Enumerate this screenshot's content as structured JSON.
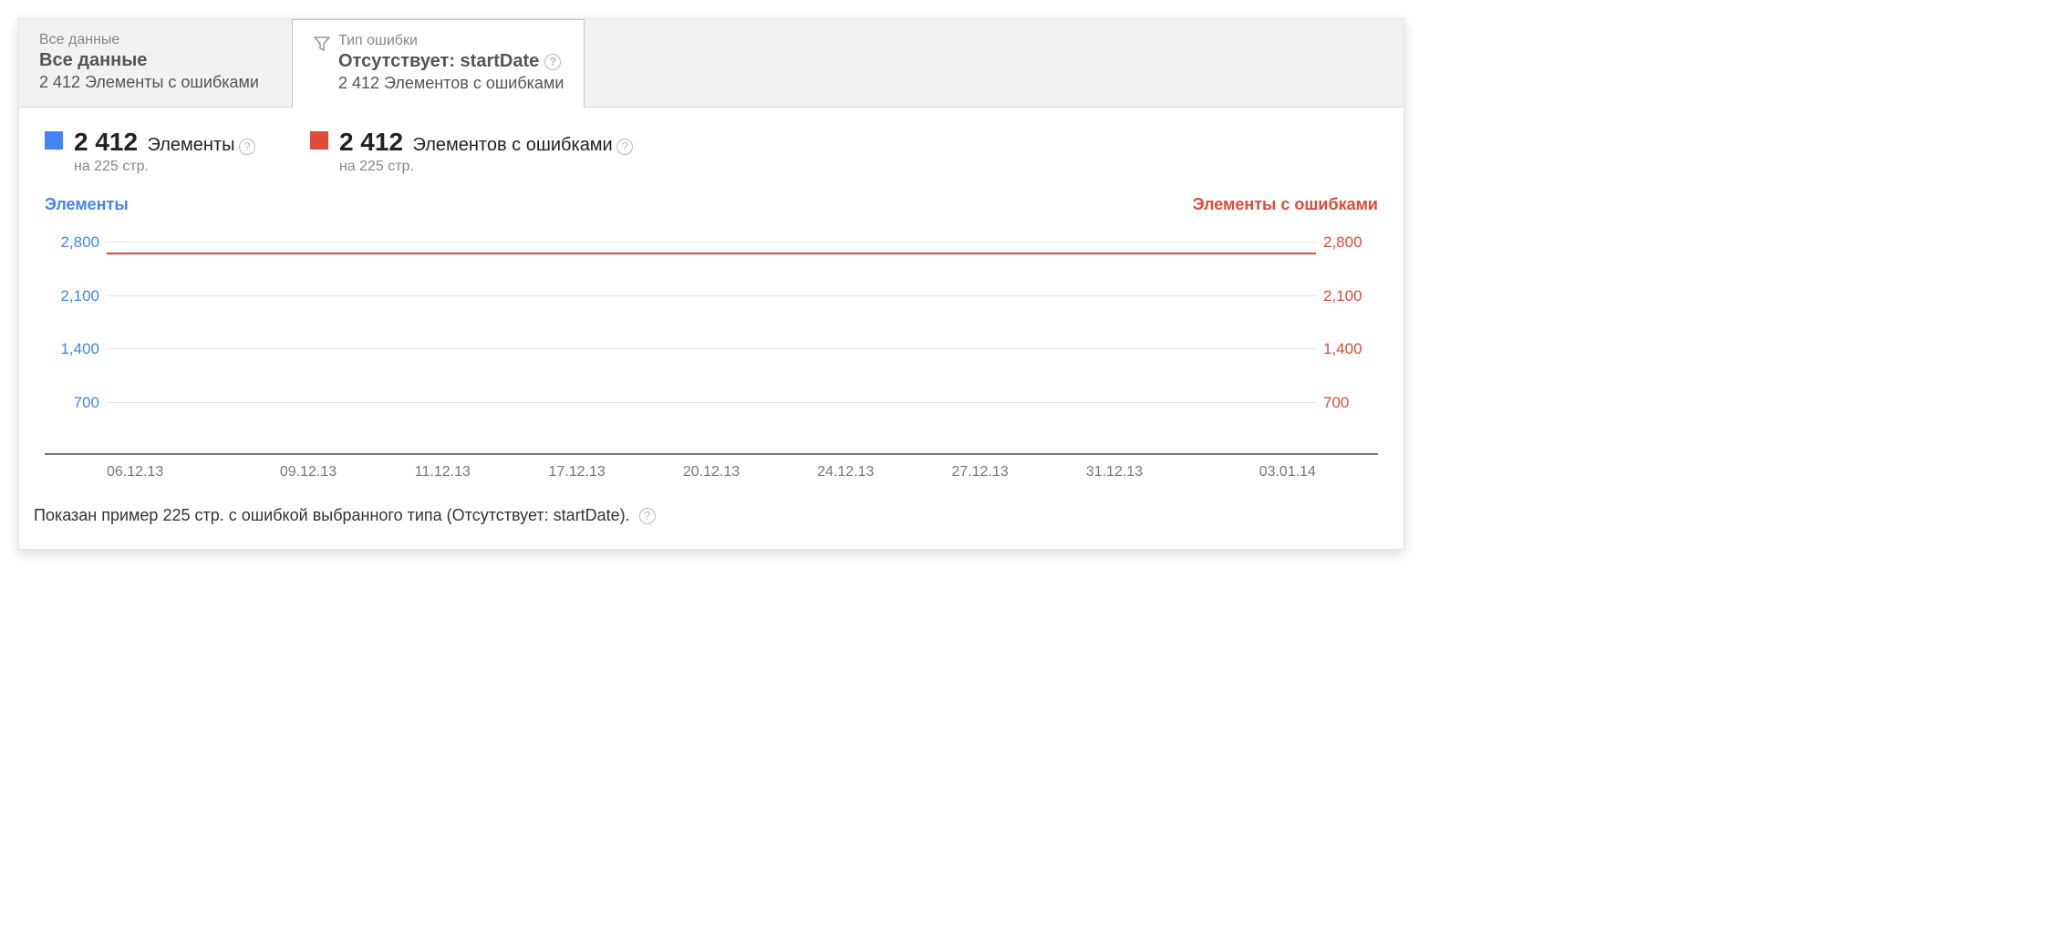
{
  "tabs": {
    "all": {
      "line1": "Все данные",
      "line2": "Все данные",
      "line3": "2 412 Элементы с ошибками"
    },
    "error_type": {
      "line1": "Тип ошибки",
      "line2": "Отсутствует: startDate",
      "line3": "2 412 Элементов с ошибками"
    }
  },
  "stats": {
    "elements": {
      "value": "2 412",
      "label": "Элементы",
      "sub": "на 225 стр."
    },
    "errors": {
      "value": "2 412",
      "label": "Элементов с ошибками",
      "sub": "на 225 стр."
    }
  },
  "chart_titles": {
    "left": "Элементы",
    "right": "Элементы с ошибками"
  },
  "y_ticks": [
    "2,800",
    "2,100",
    "1,400",
    "700"
  ],
  "x_ticks": [
    "06.12.13",
    "09.12.13",
    "11.12.13",
    "17.12.13",
    "20.12.13",
    "24.12.13",
    "27.12.13",
    "31.12.13",
    "03.01.14"
  ],
  "footer": "Показан пример 225 стр. с ошибкой выбранного типа (Отсутствует: startDate).",
  "help_glyph": "?",
  "chart_data": {
    "type": "line",
    "x": [
      "06.12.13",
      "09.12.13",
      "11.12.13",
      "17.12.13",
      "20.12.13",
      "24.12.13",
      "27.12.13",
      "31.12.13",
      "03.01.14"
    ],
    "series": [
      {
        "name": "Элементы",
        "color": "#4285f4",
        "values": [
          2650,
          2650,
          2650,
          2650,
          2670,
          2650,
          2640,
          2630,
          2620
        ]
      },
      {
        "name": "Элементы с ошибками",
        "color": "#dd4b39",
        "values": [
          2650,
          2650,
          2650,
          2650,
          2670,
          2650,
          2640,
          2630,
          2620
        ]
      }
    ],
    "ylabel_left": "Элементы",
    "ylabel_right": "Элементы с ошибками",
    "ylim": [
      0,
      2800
    ],
    "y_ticks": [
      700,
      1400,
      2100,
      2800
    ]
  }
}
